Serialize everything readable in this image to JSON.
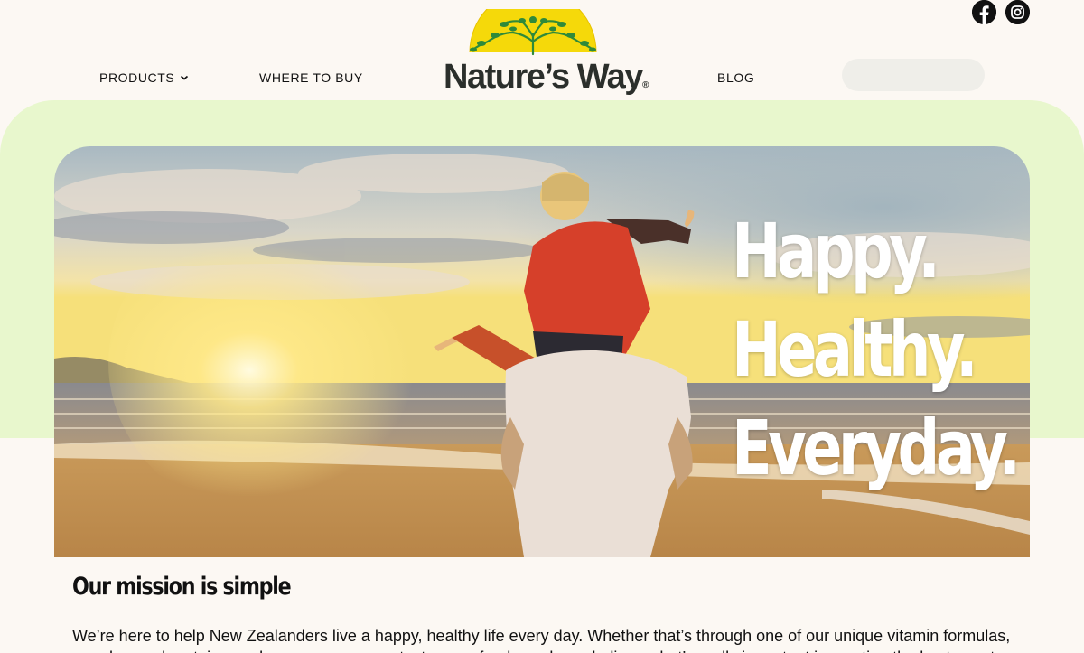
{
  "brand": {
    "name": "Nature’s Way",
    "trademark": "®"
  },
  "social": [
    {
      "name": "facebook-icon"
    },
    {
      "name": "instagram-icon"
    }
  ],
  "nav": {
    "products": "PRODUCTS",
    "where_to_buy": "WHERE TO BUY",
    "blog": "BLOG"
  },
  "search": {
    "placeholder": "",
    "value": ""
  },
  "hero": {
    "tagline": [
      "Happy.",
      "Healthy.",
      "Everyday."
    ]
  },
  "mission": {
    "title": "Our mission is simple",
    "text": "We’re here to help New Zealanders live a happy, healthy life every day. Whether that’s through one of our unique vitamin formulas, an advanced protein powder or even a super tasty superfood snack, we believe what’s really important is creating the best, most"
  },
  "colors": {
    "background": "#fcf8f3",
    "green_band": "#e8f7cd",
    "logo_sun": "#f5d90a",
    "logo_tree": "#2f8a3a"
  }
}
